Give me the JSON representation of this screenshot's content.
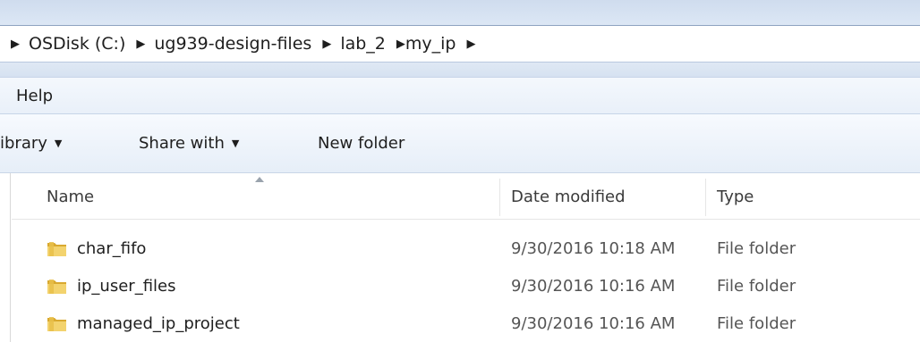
{
  "breadcrumb": [
    "OSDisk (C:)",
    "ug939-design-files",
    "lab_2",
    "my_ip"
  ],
  "menu": {
    "help_label": "Help"
  },
  "toolbar": {
    "library_label": "ibrary",
    "share_label": "Share with",
    "new_folder_label": "New folder"
  },
  "columns": {
    "name": "Name",
    "date": "Date modified",
    "type": "Type"
  },
  "files": [
    {
      "name": "char_fifo",
      "date": "9/30/2016 10:18 AM",
      "type": "File folder"
    },
    {
      "name": "ip_user_files",
      "date": "9/30/2016 10:16 AM",
      "type": "File folder"
    },
    {
      "name": "managed_ip_project",
      "date": "9/30/2016 10:16 AM",
      "type": "File folder"
    }
  ],
  "icons": {
    "folder": "folder-icon",
    "breadcrumb_arrow": "chevron-right-icon",
    "dropdown": "chevron-down-icon",
    "sort": "sort-up-icon"
  },
  "colors": {
    "chrome_blue": "#dce7f5",
    "folder_yellow": "#e8c04a"
  }
}
